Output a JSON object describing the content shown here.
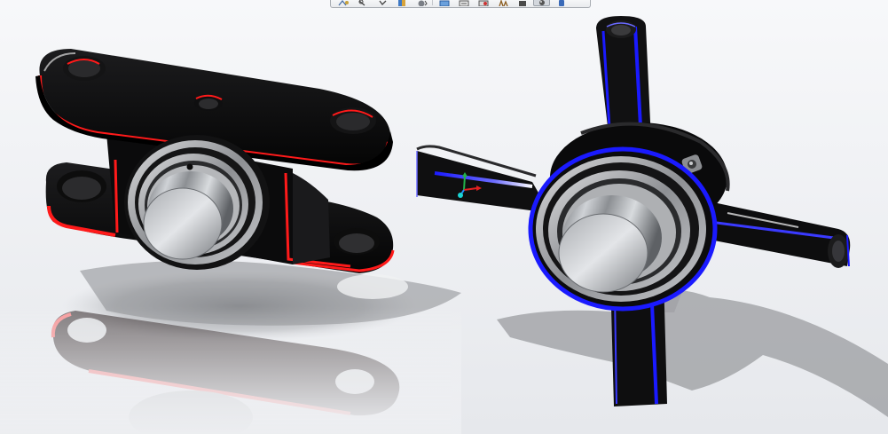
{
  "viewport": {
    "background": "#f2f3f5",
    "selection_color_1": "#ff1a1a",
    "selection_color_2": "#1a1aff"
  },
  "toolbar": {
    "buttons": [
      {
        "name": "zoom-to-fit-icon"
      },
      {
        "name": "zoom-to-area-icon"
      },
      {
        "name": "previous-view-icon"
      },
      {
        "name": "section-view-icon"
      },
      {
        "name": "view-orientation-icon"
      },
      {
        "name": "display-style-icon"
      },
      {
        "name": "hide-show-items-icon"
      },
      {
        "name": "edit-appearance-icon"
      },
      {
        "name": "apply-scene-icon"
      },
      {
        "name": "view-settings-icon"
      },
      {
        "name": "realview-icon"
      },
      {
        "name": "shadows-icon"
      }
    ]
  },
  "models": [
    {
      "name": "pillow-block-bearing",
      "highlight": "#ff1a1a"
    },
    {
      "name": "cross-shaft-bearing-assembly",
      "highlight": "#1a1aff"
    }
  ],
  "triad": {
    "name": "reference-triad"
  }
}
